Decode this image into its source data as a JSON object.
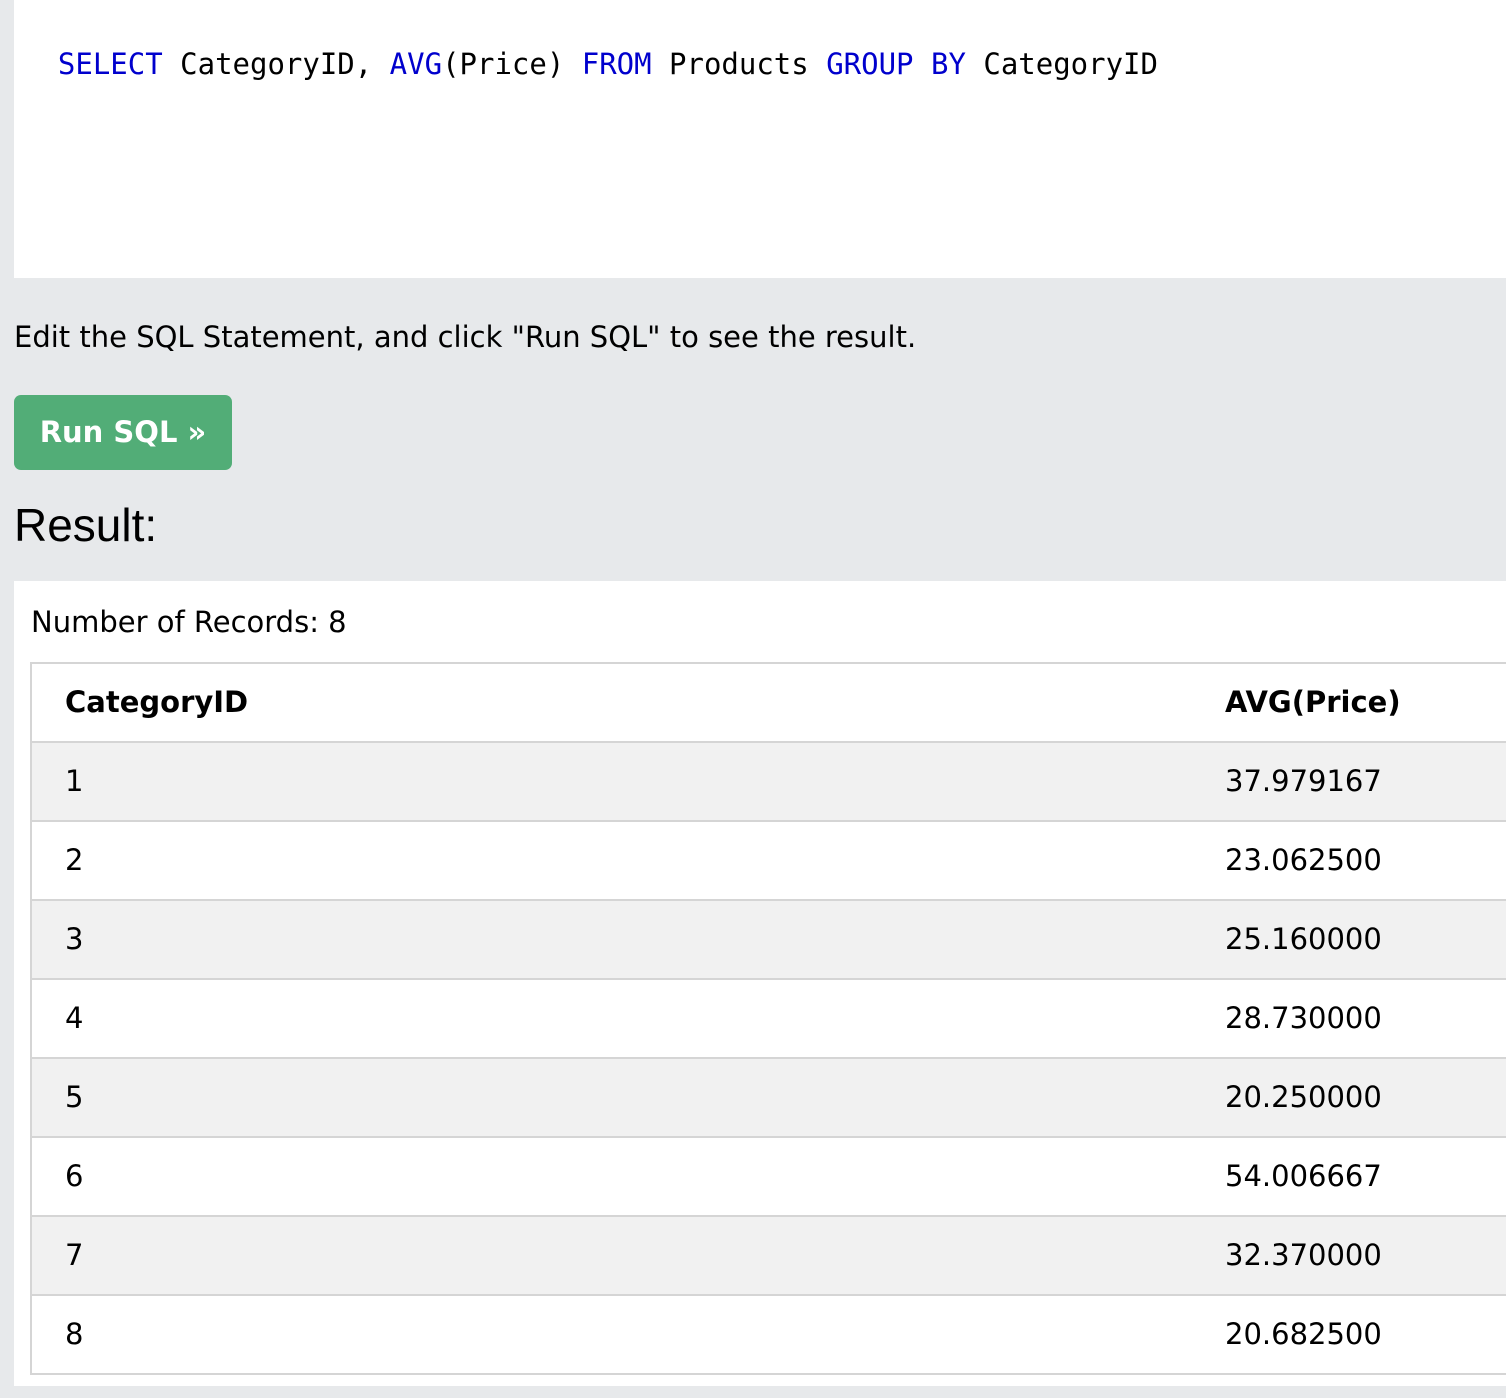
{
  "editor": {
    "tokens": [
      {
        "text": "SELECT",
        "kw": true
      },
      {
        "text": " CategoryID, ",
        "kw": false
      },
      {
        "text": "AVG",
        "kw": true
      },
      {
        "text": "(Price) ",
        "kw": false
      },
      {
        "text": "FROM",
        "kw": true
      },
      {
        "text": " Products ",
        "kw": false
      },
      {
        "text": "GROUP",
        "kw": true
      },
      {
        "text": " ",
        "kw": false
      },
      {
        "text": "BY",
        "kw": true
      },
      {
        "text": " CategoryID",
        "kw": false
      }
    ],
    "keyword_color": "#0000cd"
  },
  "instruction": "Edit the SQL Statement, and click \"Run SQL\" to see the result.",
  "run_button": {
    "label": "Run SQL »",
    "color": "#52ad77"
  },
  "result": {
    "title": "Result:",
    "records_label": "Number of Records: 8",
    "columns": [
      "CategoryID",
      "AVG(Price)"
    ],
    "rows": [
      [
        "1",
        "37.979167"
      ],
      [
        "2",
        "23.062500"
      ],
      [
        "3",
        "25.160000"
      ],
      [
        "4",
        "28.730000"
      ],
      [
        "5",
        "20.250000"
      ],
      [
        "6",
        "54.006667"
      ],
      [
        "7",
        "32.370000"
      ],
      [
        "8",
        "20.682500"
      ]
    ]
  }
}
